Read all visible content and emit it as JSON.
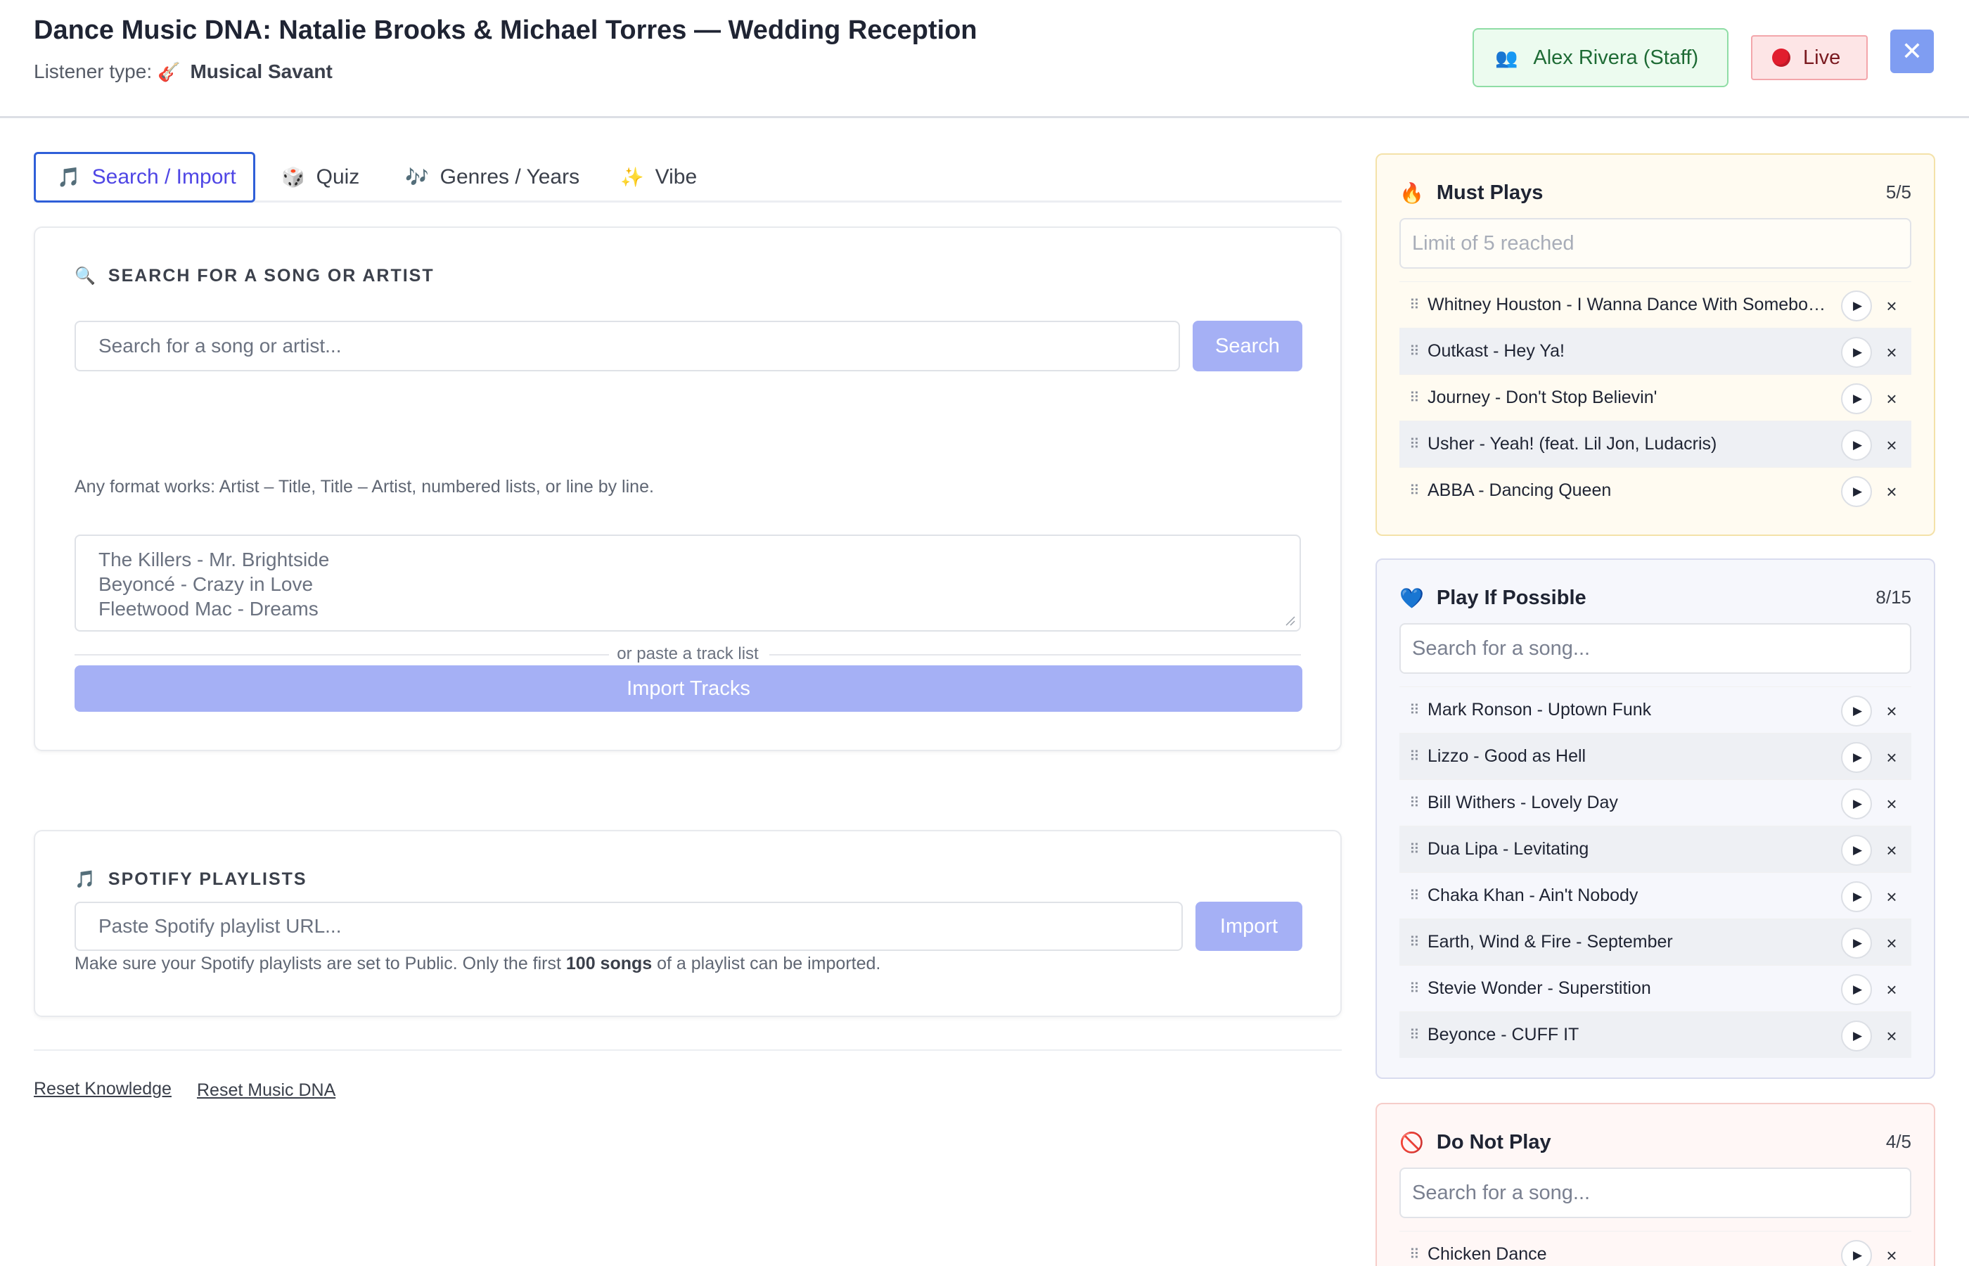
{
  "header": {
    "title": "Dance Music DNA: Natalie Brooks & Michael Torres — Wedding Reception",
    "listener_prefix": "Listener type:",
    "listener_emoji": "🎸",
    "listener_type": "Musical Savant",
    "staff_icon": "👥",
    "staff_label": "Alex Rivera (Staff)",
    "live_label": "Live",
    "close_icon": "✕"
  },
  "tabs": [
    {
      "icon": "🎵",
      "label": "Search / Import",
      "active": true
    },
    {
      "icon": "🎲",
      "label": "Quiz",
      "active": false
    },
    {
      "icon": "🎶",
      "label": "Genres / Years",
      "active": false
    },
    {
      "icon": "✨",
      "label": "Vibe",
      "active": false
    }
  ],
  "search_section": {
    "icon": "🔍",
    "heading": "SEARCH FOR A SONG OR ARTIST",
    "input_placeholder": "Search for a song or artist...",
    "search_button": "Search",
    "divider_text": "or paste a track list",
    "hint": "Any format works: Artist – Title, Title – Artist, numbered lists, or line by line.",
    "textarea_placeholder_lines": [
      "The Killers - Mr. Brightside",
      "Beyoncé - Crazy in Love",
      "Fleetwood Mac - Dreams"
    ],
    "import_button": "Import Tracks"
  },
  "spotify_section": {
    "icon": "🎵",
    "heading": "SPOTIFY PLAYLISTS",
    "input_placeholder": "Paste Spotify playlist URL...",
    "import_button": "Import",
    "note_before": "Make sure your Spotify playlists are set to Public. Only the first ",
    "note_bold": "100 songs",
    "note_after": " of a playlist can be imported."
  },
  "footer_links": {
    "reset_knowledge": "Reset Knowledge",
    "reset_dna": "Reset Music DNA"
  },
  "must_plays": {
    "icon": "🔥",
    "title": "Must Plays",
    "count": "5/5",
    "input_placeholder": "Limit of 5 reached",
    "songs": [
      "Whitney Houston - I Wanna Dance With Somebody (Who Loves Me)",
      "Outkast - Hey Ya!",
      "Journey - Don't Stop Believin'",
      "Usher - Yeah! (feat. Lil Jon, Ludacris)",
      "ABBA - Dancing Queen"
    ]
  },
  "play_if_possible": {
    "icon": "💙",
    "title": "Play If Possible",
    "count": "8/15",
    "input_placeholder": "Search for a song...",
    "songs": [
      "Mark Ronson - Uptown Funk",
      "Lizzo - Good as Hell",
      "Bill Withers - Lovely Day",
      "Dua Lipa - Levitating",
      "Chaka Khan - Ain't Nobody",
      "Earth, Wind & Fire - September",
      "Stevie Wonder - Superstition",
      "Beyonce - CUFF IT"
    ]
  },
  "do_not_play": {
    "icon": "🚫",
    "title": "Do Not Play",
    "count": "4/5",
    "input_placeholder": "Search for a song...",
    "songs": [
      "Chicken Dance"
    ]
  },
  "song_controls": {
    "play_icon": "▶",
    "remove_icon": "×",
    "drag_icon": "⠿"
  }
}
